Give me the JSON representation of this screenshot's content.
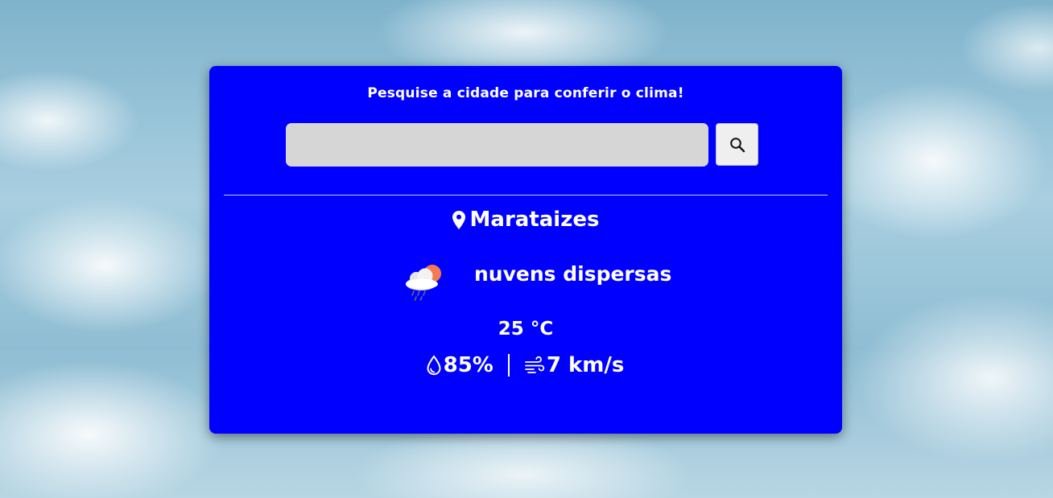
{
  "heading": "Pesquise a cidade para conferir o clima!",
  "search": {
    "value": "",
    "placeholder": "",
    "button_icon": "search-icon"
  },
  "location": {
    "icon": "map-pin-icon",
    "city": "Marataizes"
  },
  "condition": {
    "icon": "cloud-rain-sun-icon",
    "description": "nuvens dispersas"
  },
  "temperature": {
    "value": "25",
    "unit": "°C"
  },
  "humidity": {
    "icon": "water-drop-icon",
    "value": "85%"
  },
  "wind": {
    "icon": "wind-icon",
    "value": "7 km/s"
  },
  "colors": {
    "card_background": "#0000ff",
    "search_input_background": "#d6d6d6",
    "text": "#ffffff"
  }
}
